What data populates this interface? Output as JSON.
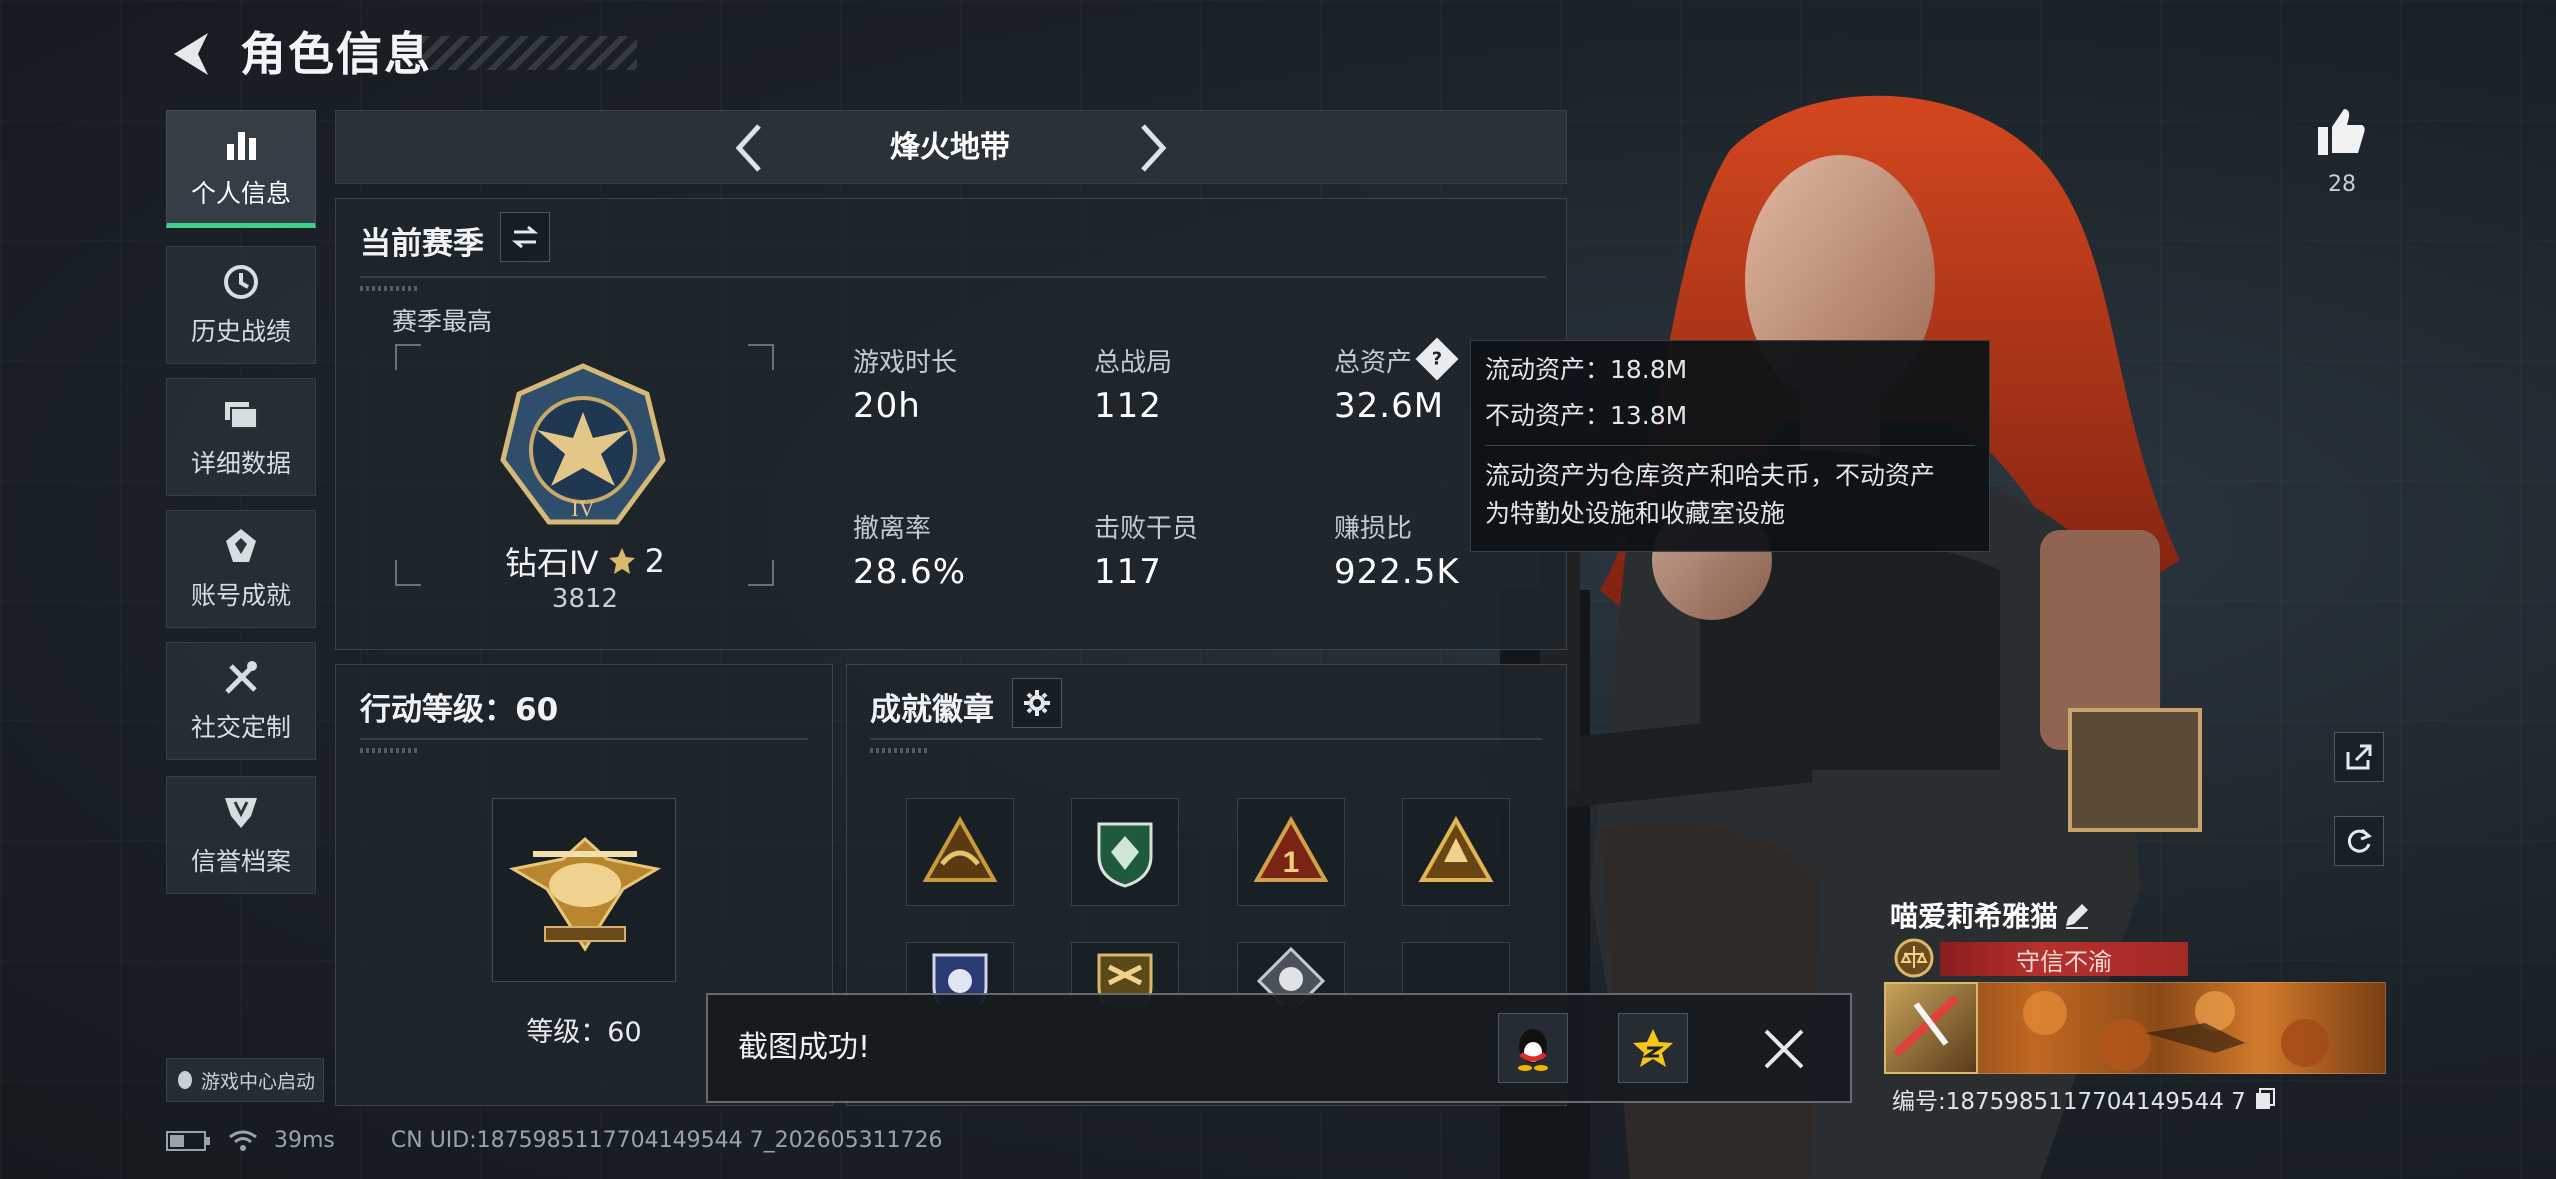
{
  "header": {
    "title": "角色信息"
  },
  "sidebar": {
    "items": [
      {
        "label": "个人信息",
        "icon": "bar-chart-icon",
        "active": true
      },
      {
        "label": "历史战绩",
        "icon": "history-icon"
      },
      {
        "label": "详细数据",
        "icon": "folder-icon"
      },
      {
        "label": "账号成就",
        "icon": "achievement-icon"
      },
      {
        "label": "社交定制",
        "icon": "tools-icon"
      },
      {
        "label": "信誉档案",
        "icon": "credit-shield-icon"
      }
    ],
    "launch_label": "游戏中心启动"
  },
  "mode": {
    "title": "烽火地带"
  },
  "season": {
    "heading": "当前赛季",
    "best_label": "赛季最高",
    "rank_name": "钻石Ⅳ",
    "rank_stars": "2",
    "rank_score": "3812",
    "stats": [
      {
        "label": "游戏时长",
        "value": "20h"
      },
      {
        "label": "总战局",
        "value": "112"
      },
      {
        "label": "总资产",
        "value": "32.6M"
      },
      {
        "label": "撤离率",
        "value": "28.6%"
      },
      {
        "label": "击败干员",
        "value": "117"
      },
      {
        "label": "赚损比",
        "value": "922.5K"
      }
    ]
  },
  "tooltip": {
    "liquid": "流动资产：18.8M",
    "fixed": "不动资产：13.8M",
    "desc_line1": "流动资产为仓库资产和哈夫币，不动资产",
    "desc_line2": "为特勤处设施和收藏室设施"
  },
  "level": {
    "heading": "行动等级：60",
    "level_label": "等级：60"
  },
  "badges": {
    "heading": "成就徽章",
    "colors": [
      "#c89a3a",
      "#2f7d55",
      "#b0442c",
      "#c89a3a",
      "#3b4d86",
      "#a98a3a",
      "#8d949a",
      "#3a4147"
    ]
  },
  "likes": {
    "count": "28"
  },
  "player": {
    "name": "喵爱莉希雅猫",
    "motto": "守信不渝",
    "uid": "编号:1875985117704149544 7"
  },
  "toast": {
    "message": "截图成功!"
  },
  "status": {
    "ping": "39ms",
    "uid_line": "CN UID:1875985117704149544 7_202605311726"
  },
  "colors": {
    "accent": "#3fd08a",
    "motto": "#b5312c",
    "gold": "#d9b86b"
  }
}
